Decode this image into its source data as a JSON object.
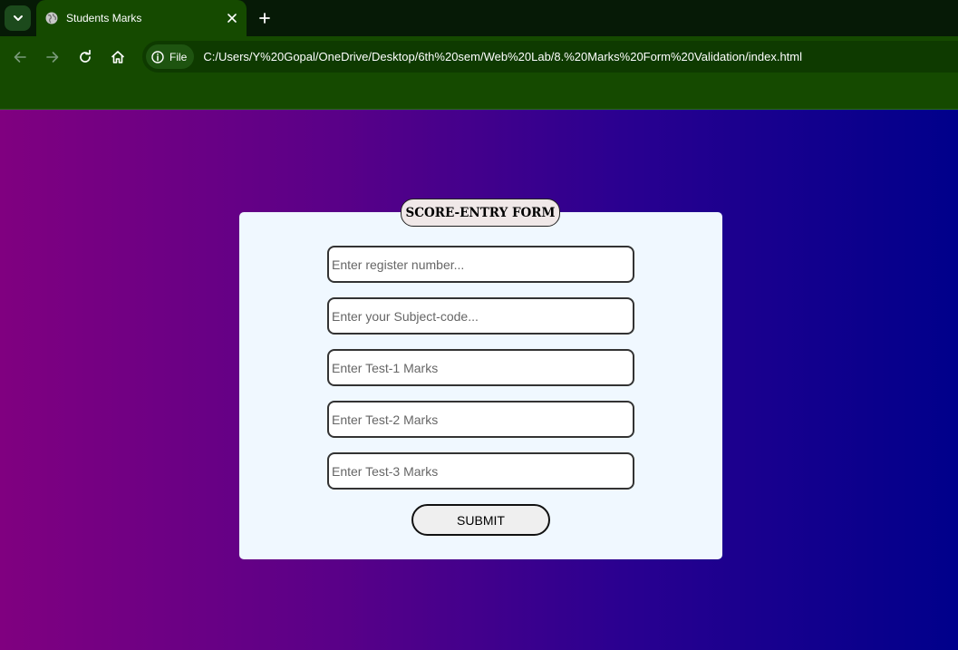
{
  "browser": {
    "tab": {
      "title": "Students Marks",
      "favicon": "globe-icon"
    },
    "icons": {
      "tab_menu": "chevron-down-icon",
      "tab_close": "close-icon",
      "new_tab": "plus-icon",
      "back": "arrow-left-icon",
      "forward": "arrow-right-icon",
      "reload": "reload-icon",
      "home": "home-icon",
      "site_info": "info-icon"
    },
    "site_chip_label": "File",
    "url": "C:/Users/Y%20Gopal/OneDrive/Desktop/6th%20sem/Web%20Lab/8.%20Marks%20Form%20Validation/index.html"
  },
  "form": {
    "legend": "SCORE-ENTRY FORM",
    "fields": [
      {
        "placeholder": "Enter register number...",
        "value": ""
      },
      {
        "placeholder": "Enter your Subject-code...",
        "value": ""
      },
      {
        "placeholder": "Enter Test-1 Marks",
        "value": ""
      },
      {
        "placeholder": "Enter Test-2 Marks",
        "value": ""
      },
      {
        "placeholder": "Enter Test-3 Marks",
        "value": ""
      }
    ],
    "submit_label": "SUBMIT"
  },
  "colors": {
    "browser_frame": "#154a00",
    "page_gradient_start": "#800080",
    "page_gradient_end": "#00008b",
    "card_background": "#f0f8ff",
    "legend_background": "#f0e8e8"
  }
}
